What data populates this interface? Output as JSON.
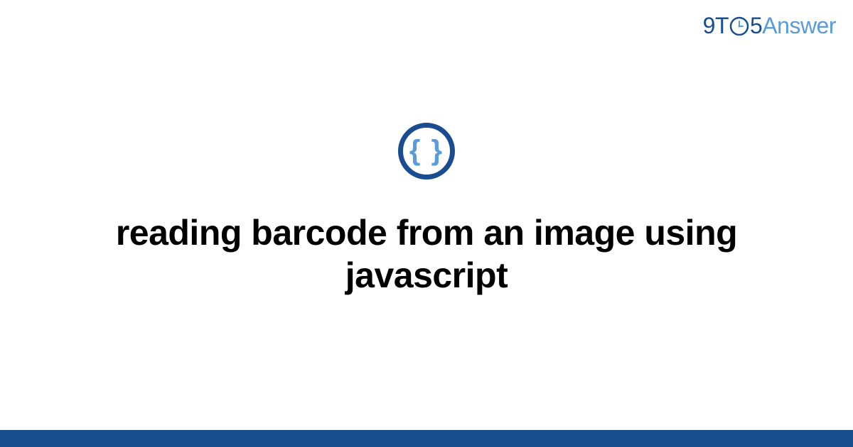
{
  "header": {
    "logo": {
      "part1": "9T",
      "part2": "5",
      "part3": "Answer"
    }
  },
  "icon": {
    "braces": "{ }"
  },
  "main": {
    "title": "reading barcode from an image using javascript"
  },
  "colors": {
    "primary": "#1a4d8f",
    "secondary": "#5a9bd8"
  }
}
